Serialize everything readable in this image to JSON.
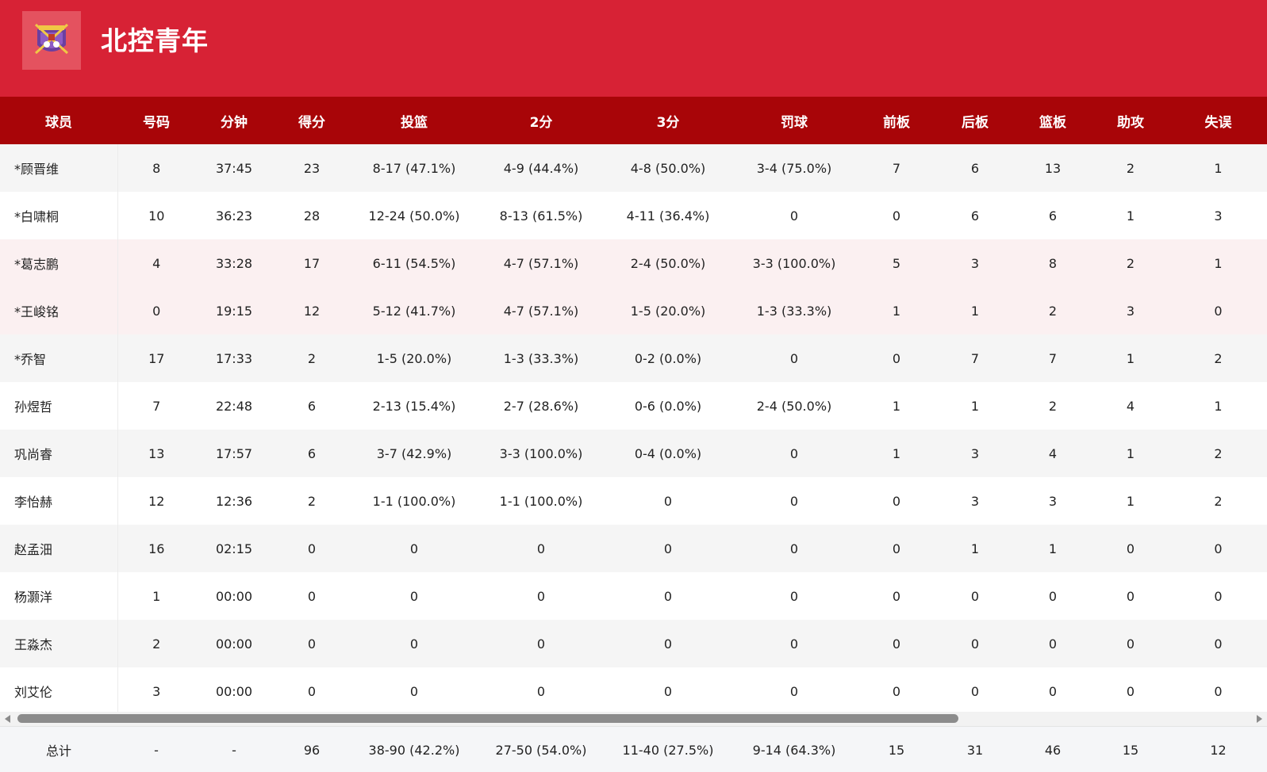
{
  "team": {
    "name": "北控青年",
    "logo_icon": "team-crest-icon",
    "header_color": "#d72235"
  },
  "columns": [
    "球员",
    "号码",
    "分钟",
    "得分",
    "投篮",
    "2分",
    "3分",
    "罚球",
    "前板",
    "后板",
    "篮板",
    "助攻",
    "失误"
  ],
  "players": [
    [
      "*顾晋维",
      "8",
      "37:45",
      "23",
      "8-17 (47.1%)",
      "4-9 (44.4%)",
      "4-8 (50.0%)",
      "3-4 (75.0%)",
      "7",
      "6",
      "13",
      "2",
      "1"
    ],
    [
      "*白啸桐",
      "10",
      "36:23",
      "28",
      "12-24 (50.0%)",
      "8-13 (61.5%)",
      "4-11 (36.4%)",
      "0",
      "0",
      "6",
      "6",
      "1",
      "3"
    ],
    [
      "*葛志鹏",
      "4",
      "33:28",
      "17",
      "6-11 (54.5%)",
      "4-7 (57.1%)",
      "2-4 (50.0%)",
      "3-3 (100.0%)",
      "5",
      "3",
      "8",
      "2",
      "1"
    ],
    [
      "*王峻铭",
      "0",
      "19:15",
      "12",
      "5-12 (41.7%)",
      "4-7 (57.1%)",
      "1-5 (20.0%)",
      "1-3 (33.3%)",
      "1",
      "1",
      "2",
      "3",
      "0"
    ],
    [
      " *乔智",
      "17",
      "17:33",
      "2",
      "1-5 (20.0%)",
      "1-3 (33.3%)",
      "0-2 (0.0%)",
      "0",
      "0",
      "7",
      "7",
      "1",
      "2"
    ],
    [
      "孙煜哲",
      "7",
      "22:48",
      "6",
      "2-13 (15.4%)",
      "2-7 (28.6%)",
      "0-6 (0.0%)",
      "2-4 (50.0%)",
      "1",
      "1",
      "2",
      "4",
      "1"
    ],
    [
      "巩尚睿",
      "13",
      "17:57",
      "6",
      "3-7 (42.9%)",
      "3-3 (100.0%)",
      "0-4 (0.0%)",
      "0",
      "1",
      "3",
      "4",
      "1",
      "2"
    ],
    [
      "李怡赫",
      "12",
      "12:36",
      "2",
      "1-1 (100.0%)",
      "1-1 (100.0%)",
      "0",
      "0",
      "0",
      "3",
      "3",
      "1",
      "2"
    ],
    [
      "赵孟沺",
      "16",
      "02:15",
      "0",
      "0",
      "0",
      "0",
      "0",
      "0",
      "1",
      "1",
      "0",
      "0"
    ],
    [
      "杨灏洋",
      "1",
      "00:00",
      "0",
      "0",
      "0",
      "0",
      "0",
      "0",
      "0",
      "0",
      "0",
      "0"
    ],
    [
      "王淼杰",
      "2",
      "00:00",
      "0",
      "0",
      "0",
      "0",
      "0",
      "0",
      "0",
      "0",
      "0",
      "0"
    ],
    [
      "刘艾伦",
      "3",
      "00:00",
      "0",
      "0",
      "0",
      "0",
      "0",
      "0",
      "0",
      "0",
      "0",
      "0"
    ]
  ],
  "totals": [
    "总计",
    "-",
    "-",
    "96",
    "38-90 (42.2%)",
    "27-50 (54.0%)",
    "11-40 (27.5%)",
    "9-14 (64.3%)",
    "15",
    "31",
    "46",
    "15",
    "12"
  ],
  "colors": {
    "table_header": "#a80508",
    "row_highlight": "#fbf0f1"
  }
}
